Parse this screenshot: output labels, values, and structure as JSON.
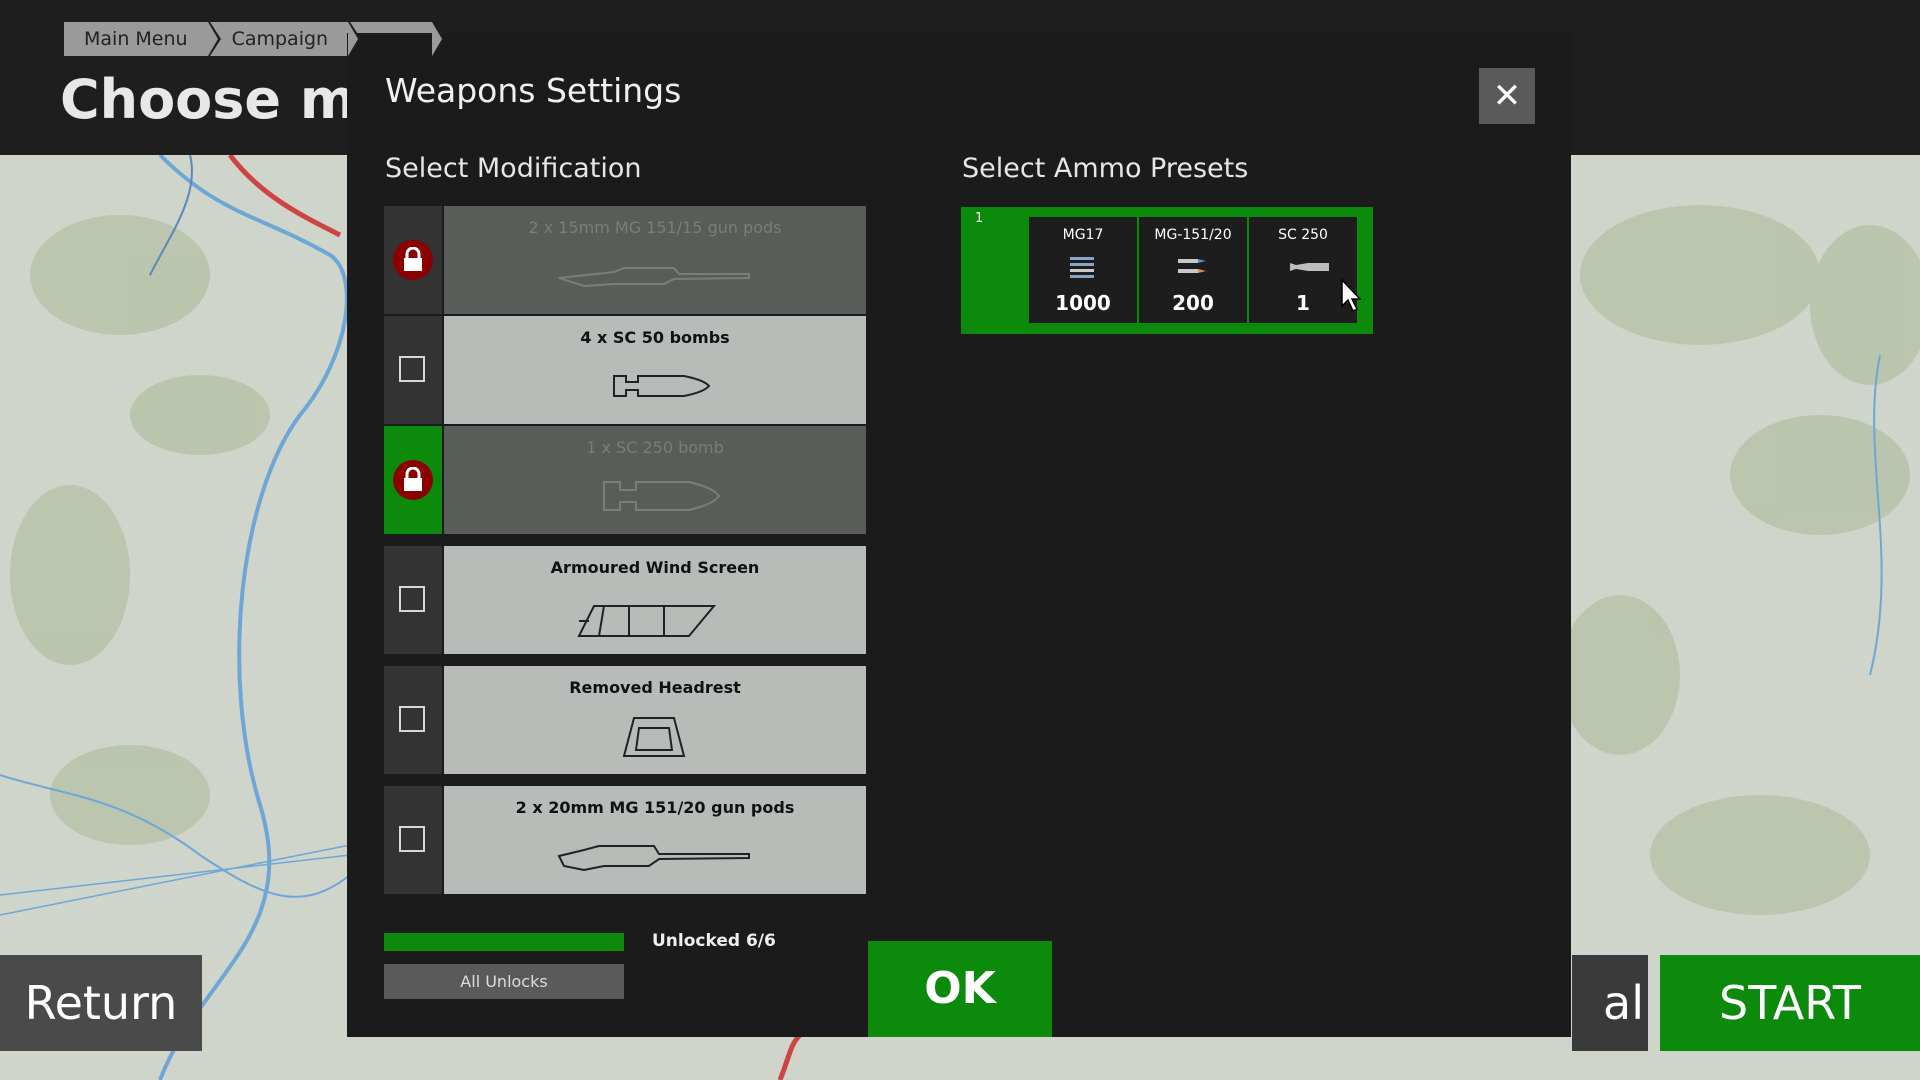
{
  "breadcrumbs": [
    "Main Menu",
    "Campaign",
    ""
  ],
  "page_title": "Choose miss",
  "bottom": {
    "return_label": "Return",
    "partial_label": "al",
    "start_label": "START"
  },
  "modal": {
    "title": "Weapons Settings",
    "close_label": "✕",
    "modifications_title": "Select Modification",
    "ammo_title": "Select Ammo Presets",
    "modifications": [
      {
        "label": "2 x 15mm MG 151/15 gun pods",
        "state": "locked"
      },
      {
        "label": "4 x SC 50 bombs",
        "state": "unchecked"
      },
      {
        "label": "1 x SC 250 bomb",
        "state": "locked-selected"
      },
      {
        "label": "Armoured Wind Screen",
        "state": "unchecked"
      },
      {
        "label": "Removed Headrest",
        "state": "unchecked"
      },
      {
        "label": "2 x 20mm MG 151/20 gun pods",
        "state": "unchecked"
      }
    ],
    "unlock_text": "Unlocked 6/6",
    "unlock_progress": 1.0,
    "all_unlocks_label": "All Unlocks",
    "ok_label": "OK",
    "preset": {
      "number": "1",
      "slots": [
        {
          "name": "MG17",
          "value": "1000",
          "icon": "bullet-belt-icon"
        },
        {
          "name": "MG-151/20",
          "value": "200",
          "icon": "cannon-round-icon"
        },
        {
          "name": "SC 250",
          "value": "1",
          "icon": "bomb-icon"
        }
      ]
    }
  },
  "colors": {
    "accent_green": "#0c8a0c",
    "lock_red": "#8b0000",
    "panel": "#1b1b1b"
  }
}
